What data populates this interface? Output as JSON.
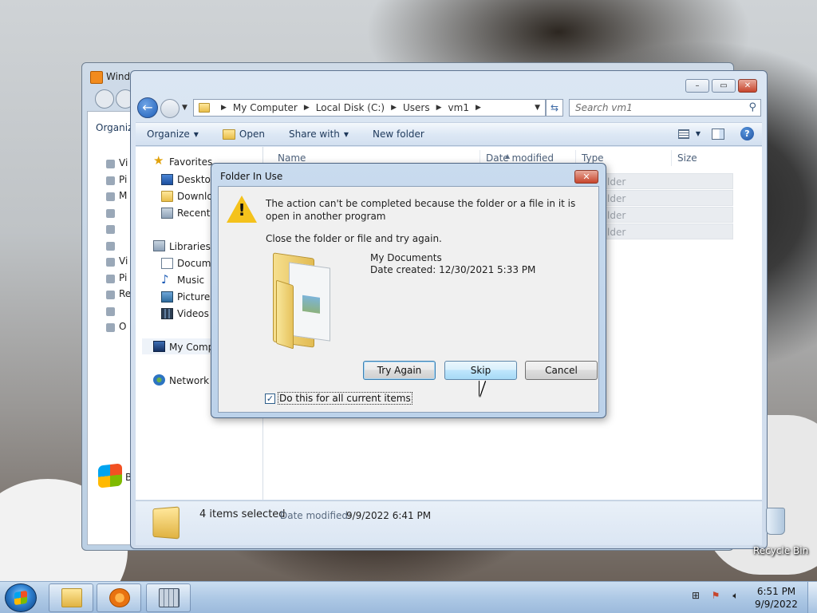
{
  "background_window": {
    "title": "Windo",
    "toolbar_label": "Organiz",
    "nav_items": [
      "Vi",
      "Pi",
      "M",
      "",
      "",
      "",
      "Vi",
      "Pi",
      "Re",
      "",
      "O"
    ],
    "start_partial": "B"
  },
  "explorer": {
    "breadcrumb": [
      "My Computer",
      "Local Disk (C:)",
      "Users",
      "vm1"
    ],
    "search_placeholder": "Search vm1",
    "commands": {
      "organize": "Organize",
      "open": "Open",
      "share_with": "Share with",
      "new_folder": "New folder"
    },
    "nav": {
      "favorites": "Favorites",
      "desktop": "Desktop",
      "downloads": "Downlo",
      "recent": "Recent P",
      "libraries": "Libraries",
      "documents": "Docume",
      "music": "Music",
      "pictures": "Pictures",
      "videos": "Videos",
      "my_computer": "My Comp",
      "network": "Network"
    },
    "columns": {
      "name": "Name",
      "date_modified": "Date modified",
      "type": "Type",
      "size": "Size"
    },
    "rows": [
      {
        "type": "lder"
      },
      {
        "type": "lder"
      },
      {
        "type": "lder"
      },
      {
        "type": "lder"
      }
    ],
    "details": {
      "count": "4 items selected",
      "modified_label": "Date modified:",
      "modified_value": "9/9/2022 6:41 PM"
    }
  },
  "dialog": {
    "title": "Folder In Use",
    "message": "The action can't be completed because the folder or a file in it is open in another program",
    "instruction": "Close the folder or file and try again.",
    "item_name": "My Documents",
    "item_created": "Date created: 12/30/2021 5:33 PM",
    "buttons": {
      "try_again": "Try Again",
      "skip": "Skip",
      "cancel": "Cancel"
    },
    "checkbox_label": "Do this for all current items",
    "checkbox_checked": true
  },
  "desktop": {
    "recycle_bin_label": "Recycle Bin"
  },
  "taskbar": {
    "time": "6:51 PM",
    "date": "9/9/2022"
  }
}
